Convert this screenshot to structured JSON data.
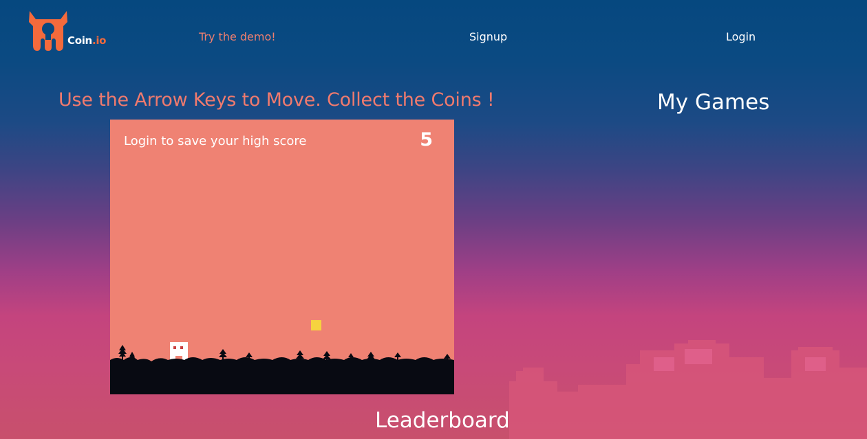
{
  "nav": {
    "logo_text": "Coin",
    "logo_tld": ".io",
    "demo_label": "Try the demo!",
    "signup_label": "Signup",
    "login_label": "Login"
  },
  "main": {
    "instructions": "Use the Arrow Keys to Move. Collect the Coins !",
    "my_games_title": "My Games",
    "leaderboard_title": "Leaderboard"
  },
  "game": {
    "hint": "Login to save your high score",
    "score": "5"
  },
  "colors": {
    "accent": "#ef7a6e",
    "logo": "#f46a3c",
    "game_background": "#ef8273",
    "coin": "#f6d33f",
    "ground": "#080a12"
  }
}
